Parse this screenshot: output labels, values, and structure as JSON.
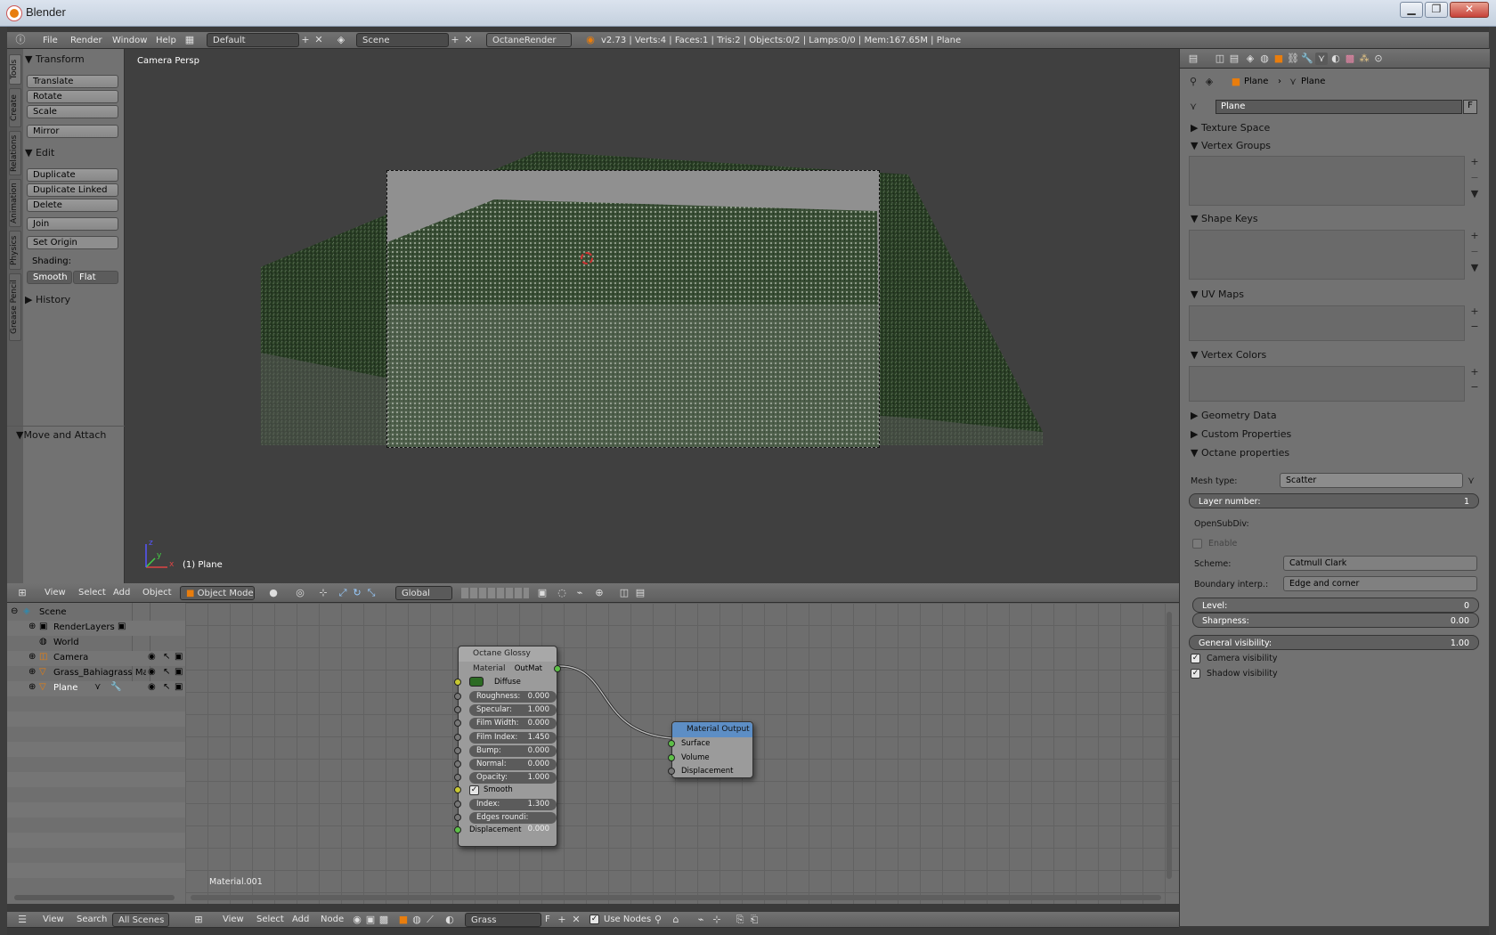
{
  "window": {
    "title": "Blender",
    "min": "▁",
    "max": "❐",
    "close": "✕"
  },
  "info_bar": {
    "menus": [
      "File",
      "Render",
      "Window",
      "Help"
    ],
    "layout": "Default",
    "scene": "Scene",
    "engine": "OctaneRender",
    "stats": "v2.73 | Verts:4 | Faces:1 | Tris:2 | Objects:0/2 | Lamps:0/0 | Mem:167.65M | Plane"
  },
  "toolshelf": {
    "tabs": [
      "Tools",
      "Create",
      "Relations",
      "Animation",
      "Physics",
      "Grease Pencil"
    ],
    "transform_title": "Transform",
    "transform": [
      "Translate",
      "Rotate",
      "Scale"
    ],
    "mirror": "Mirror",
    "edit_title": "Edit",
    "edit": [
      "Duplicate",
      "Duplicate Linked",
      "Delete"
    ],
    "join": "Join",
    "set_origin": "Set Origin",
    "shading_label": "Shading:",
    "smooth": "Smooth",
    "flat": "Flat",
    "history_title": "History",
    "move_attach": "Move and Attach"
  },
  "viewport": {
    "label": "Camera Persp",
    "object_label": "(1) Plane",
    "axis_x": "x",
    "axis_y": "y",
    "axis_z": "z"
  },
  "view3d_header": {
    "menus": [
      "View",
      "Select",
      "Add",
      "Object"
    ],
    "mode": "Object Mode",
    "orientation": "Global"
  },
  "outliner": {
    "items": [
      {
        "label": "Scene",
        "icon": "scene-icon"
      },
      {
        "label": "RenderLayers",
        "icon": "renderlayers-icon"
      },
      {
        "label": "World",
        "icon": "world-icon"
      },
      {
        "label": "Camera",
        "icon": "camera-icon"
      },
      {
        "label": "Grass_Bahiagrass Master",
        "icon": "mesh-icon"
      },
      {
        "label": "Plane",
        "icon": "mesh-icon"
      }
    ],
    "header": {
      "menus": [
        "View",
        "Search"
      ],
      "filter": "All Scenes"
    }
  },
  "node_editor": {
    "glossy": {
      "title": "Octane Glossy Material",
      "output": "OutMat",
      "diffuse": "Diffuse",
      "rows": [
        {
          "label": "Roughness:",
          "value": "0.000"
        },
        {
          "label": "Specular:",
          "value": "1.000"
        },
        {
          "label": "Film Width:",
          "value": "0.000"
        },
        {
          "label": "Film Index:",
          "value": "1.450"
        },
        {
          "label": "Bump:",
          "value": "0.000"
        },
        {
          "label": "Normal:",
          "value": "0.000"
        },
        {
          "label": "Opacity:",
          "value": "1.000"
        }
      ],
      "smooth": "Smooth",
      "rows2": [
        {
          "label": "Index:",
          "value": "1.300"
        },
        {
          "label": "Edges roundi:",
          "value": "0.000"
        }
      ],
      "displacement": "Displacement"
    },
    "output_node": {
      "title": "Material Output",
      "inputs": [
        "Surface",
        "Volume",
        "Displacement"
      ]
    },
    "material_label": "Material.001",
    "header": {
      "menus": [
        "View",
        "Select",
        "Add",
        "Node"
      ],
      "material": "Grass",
      "fake": "F",
      "use_nodes": "Use Nodes"
    }
  },
  "properties": {
    "breadcrumb": [
      "Plane",
      "Plane"
    ],
    "datablock": "Plane",
    "datablock_f": "F",
    "sections": {
      "texture_space": "Texture Space",
      "vertex_groups": "Vertex Groups",
      "shape_keys": "Shape Keys",
      "uv_maps": "UV Maps",
      "vertex_colors": "Vertex Colors",
      "geometry_data": "Geometry Data",
      "custom_properties": "Custom Properties",
      "octane_properties": "Octane properties"
    },
    "octane": {
      "mesh_type_label": "Mesh type:",
      "mesh_type": "Scatter",
      "layer_label": "Layer number:",
      "layer_value": "1",
      "opensubdiv": "OpenSubDiv:",
      "enable": "Enable",
      "scheme_label": "Scheme:",
      "scheme": "Catmull Clark",
      "boundary_label": "Boundary interp.:",
      "boundary": "Edge and corner",
      "level_label": "Level:",
      "level_value": "0",
      "sharpness_label": "Sharpness:",
      "sharpness_value": "0.00",
      "visibility_label": "General visibility:",
      "visibility_value": "1.00",
      "camera_vis": "Camera visibility",
      "shadow_vis": "Shadow visibility"
    }
  },
  "colors": {
    "accent": "#e87d0d",
    "header": "#6a6a6a",
    "panel": "#727272",
    "socket_green": "#5ec048",
    "socket_yellow": "#c8c832"
  }
}
